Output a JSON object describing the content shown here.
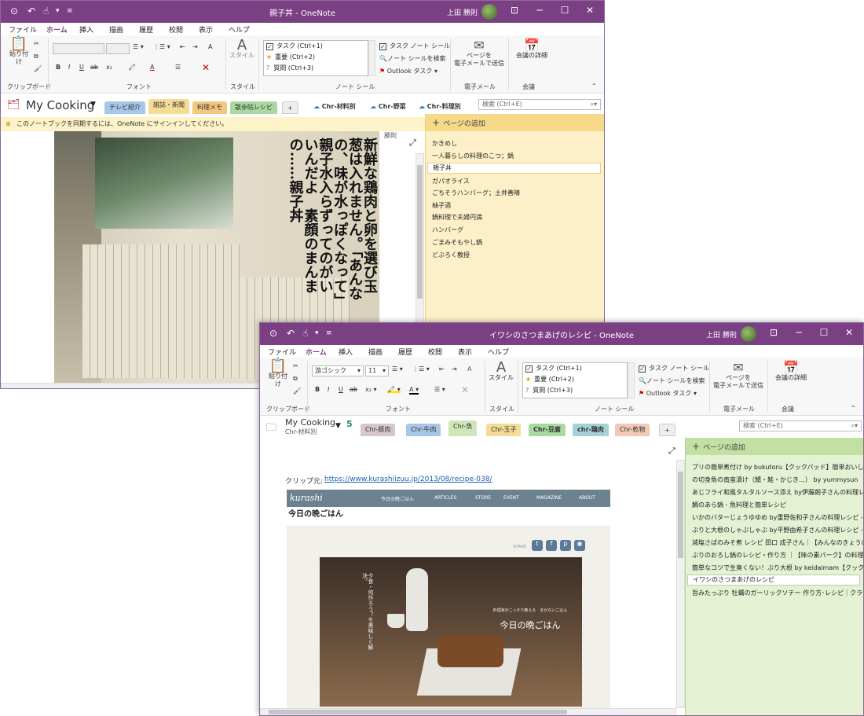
{
  "window1": {
    "title": "親子丼 - OneNote",
    "user": "上田 勝則",
    "menu": [
      "ファイル",
      "ホーム",
      "挿入",
      "描画",
      "履歴",
      "校閲",
      "表示",
      "ヘルプ"
    ],
    "ribbon": {
      "paste_label": "貼り付け",
      "clipboard_group": "クリップボード",
      "font_group": "フォント",
      "style_label": "スタイル",
      "style_group": "スタイル",
      "tags": [
        "タスク (Ctrl+1)",
        "重要 (Ctrl+2)",
        "質問 (Ctrl+3)"
      ],
      "task_tag": "タスク ノート シール",
      "find_tags": "ノート シールを検索",
      "outlook_tasks": "Outlook タスク",
      "tags_group": "ノート シール",
      "email_label_1": "ページを",
      "email_label_2": "電子メールで送信",
      "email_group": "電子メール",
      "meeting_label": "会議の詳細",
      "meeting_group": "会議"
    },
    "notebook": "My Cooking",
    "tabs": [
      "テレビ紹介",
      "雑誌・新聞",
      "料理メモ",
      "散歩帖レシピ"
    ],
    "plus": "+",
    "chr_tabs": [
      "Chr-材料別",
      "Chr-野菜",
      "Chr-料理別"
    ],
    "search_placeholder": "検索 (Ctrl+E)",
    "info": "このノートブックを同期するには、OneNote にサインインしてください。",
    "add_page": "ページの追加",
    "pages": [
      "かきめし",
      "一人暮らしの料理のこつ；鍋",
      "親子丼",
      "ガパオライス",
      "ごちそうハンバーグ；土井善晴",
      "柚子酒",
      "鍋料理で夫婦円満",
      "ハンバーグ",
      "ごまみそもやし鍋",
      "どぶろく教授"
    ],
    "selected_page_index": 2,
    "magazine_heading": "新鮮な鶏肉と卵を選び玉葱は入れません。「あんなの、味が水っぽくなって」親子水入らずってのがいいんだよ　素顔のまんまの……親子丼",
    "margin_note": "勝則"
  },
  "window2": {
    "title": "イワシのさつまあげのレシピ - OneNote",
    "user": "上田 勝則",
    "menu": [
      "ファイル",
      "ホーム",
      "挿入",
      "描画",
      "履歴",
      "校閲",
      "表示",
      "ヘルプ"
    ],
    "ribbon": {
      "paste_label": "貼り付け",
      "clipboard_group": "クリップボード",
      "font_name": "游ゴシック",
      "font_size": "11",
      "font_group": "フォント",
      "style_label": "スタイル",
      "style_group": "スタイル",
      "tags": [
        "タスク (Ctrl+1)",
        "重要 (Ctrl+2)",
        "質問 (Ctrl+3)"
      ],
      "task_tag": "タスク ノート シール",
      "find_tags": "ノート シールを検索",
      "outlook_tasks": "Outlook タスク",
      "tags_group": "ノート シール",
      "email_label_1": "ページを",
      "email_label_2": "電子メールで送信",
      "email_group": "電子メール",
      "meeting_label": "会議の詳細",
      "meeting_group": "会議"
    },
    "notebook": "My Cooking",
    "section": "Chr-材料別",
    "section_count": "5",
    "tabs": [
      "Chr-豚肉",
      "Chr-牛肉",
      "Chr-魚",
      "Chr-玉子",
      "Chr-豆腐",
      "chr-鶏肉",
      "Chr-乾物"
    ],
    "plus": "+",
    "search_placeholder": "検索 (Ctrl+E)",
    "add_page": "ページの追加",
    "clip_label": "クリップ元:",
    "clip_url": "https://www.kurashiizuu.jp/2013/08/recipe-038/",
    "site_logo": "kurashi",
    "site_nav": [
      "今日の晩ごはん",
      "ARTICLES",
      "STORE",
      "EVENT",
      "MAGAZINE",
      "ABOUT"
    ],
    "article_heading": "今日の晩ごはん",
    "share": "SHARE",
    "photo_caption": "今日の晩ごはん",
    "photo_sub": "料理家がこっそり教える　まかないごはん",
    "photo_vertical": "夕食・何作ろう？を美味しく解決。",
    "pages": [
      "ブリの簡単煮付け by bukutoru【クックパッド】簡単おいしい",
      "の切身魚の南蛮漬け（鯖・鮭・かじき…） by yummysun",
      "あじフライ和風タルタルソース添え by伊藤朗子さんの料理レ",
      "鯛のあら鍋 - 魚料理と簡単レシピ",
      "いかのバターじょうゆゆめ by重野佐和子さんの料理レシピ -",
      "ぶりと大根のしゃぶしゃぶ by平野由希子さんの料理レシピ -",
      "減塩さばのみそ煮 レシピ 田口 成子さん｜【みんなのきょうの",
      "ぶりのおろし鍋のレシピ・作り方 ｜【味の素パーク】の料理・レ",
      "簡単なコツで生臭くない！ぶり大根 by keidaimam【クック",
      "イワシのさつまあげのレシピ",
      "旨みたっぷり 牡蠣のガーリックソテー 作り方･レシピ｜クラシル"
    ],
    "selected_page_index": 9
  }
}
